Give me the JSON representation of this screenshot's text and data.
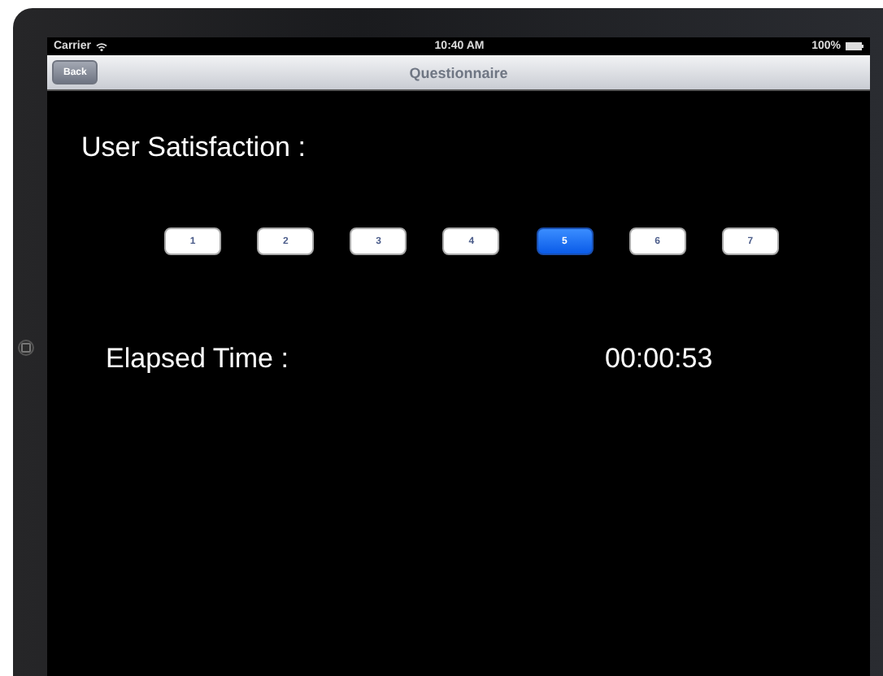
{
  "status_bar": {
    "carrier": "Carrier",
    "time": "10:40 AM",
    "battery": "100%"
  },
  "nav_bar": {
    "back": "Back",
    "title": "Questionnaire"
  },
  "satisfaction": {
    "label": "User Satisfaction :",
    "options": [
      {
        "label": "1",
        "selected": false
      },
      {
        "label": "2",
        "selected": false
      },
      {
        "label": "3",
        "selected": false
      },
      {
        "label": "4",
        "selected": false
      },
      {
        "label": "5",
        "selected": true
      },
      {
        "label": "6",
        "selected": false
      },
      {
        "label": "7",
        "selected": false
      }
    ]
  },
  "elapsed": {
    "label": "Elapsed Time :",
    "value": "00:00:53"
  }
}
